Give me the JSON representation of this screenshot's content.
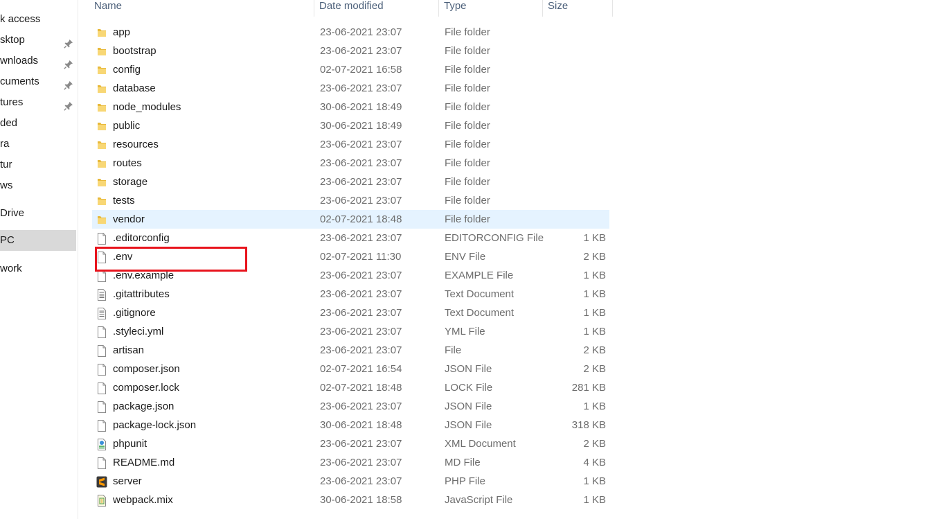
{
  "sidebar": {
    "items": [
      {
        "label": "k access",
        "icon": "star-icon",
        "pinned": false,
        "selected": false
      },
      {
        "label": "sktop",
        "icon": "desktop-icon",
        "pinned": true,
        "selected": false
      },
      {
        "label": "wnloads",
        "icon": "download-icon",
        "pinned": true,
        "selected": false
      },
      {
        "label": "cuments",
        "icon": "document-icon",
        "pinned": true,
        "selected": false
      },
      {
        "label": "tures",
        "icon": "picture-icon",
        "pinned": true,
        "selected": false
      },
      {
        "label": "ded",
        "icon": "folder-icon",
        "pinned": false,
        "selected": false
      },
      {
        "label": "ra",
        "icon": "folder-icon",
        "pinned": false,
        "selected": false
      },
      {
        "label": "tur",
        "icon": "folder-icon",
        "pinned": false,
        "selected": false
      },
      {
        "label": "ws",
        "icon": "folder-icon",
        "pinned": false,
        "selected": false
      },
      {
        "label": "Drive",
        "icon": "cloud-icon",
        "pinned": false,
        "selected": false
      },
      {
        "label": "PC",
        "icon": "computer-icon",
        "pinned": false,
        "selected": true
      },
      {
        "label": "work",
        "icon": "network-icon",
        "pinned": false,
        "selected": false
      }
    ]
  },
  "columns": {
    "name": "Name",
    "date": "Date modified",
    "type": "Type",
    "size": "Size"
  },
  "files": [
    {
      "name": "app",
      "date": "23-06-2021 23:07",
      "type": "File folder",
      "size": "",
      "icon": "folder-icon"
    },
    {
      "name": "bootstrap",
      "date": "23-06-2021 23:07",
      "type": "File folder",
      "size": "",
      "icon": "folder-icon"
    },
    {
      "name": "config",
      "date": "02-07-2021 16:58",
      "type": "File folder",
      "size": "",
      "icon": "folder-icon"
    },
    {
      "name": "database",
      "date": "23-06-2021 23:07",
      "type": "File folder",
      "size": "",
      "icon": "folder-icon"
    },
    {
      "name": "node_modules",
      "date": "30-06-2021 18:49",
      "type": "File folder",
      "size": "",
      "icon": "folder-icon"
    },
    {
      "name": "public",
      "date": "30-06-2021 18:49",
      "type": "File folder",
      "size": "",
      "icon": "folder-icon"
    },
    {
      "name": "resources",
      "date": "23-06-2021 23:07",
      "type": "File folder",
      "size": "",
      "icon": "folder-icon"
    },
    {
      "name": "routes",
      "date": "23-06-2021 23:07",
      "type": "File folder",
      "size": "",
      "icon": "folder-icon"
    },
    {
      "name": "storage",
      "date": "23-06-2021 23:07",
      "type": "File folder",
      "size": "",
      "icon": "folder-icon"
    },
    {
      "name": "tests",
      "date": "23-06-2021 23:07",
      "type": "File folder",
      "size": "",
      "icon": "folder-icon"
    },
    {
      "name": "vendor",
      "date": "02-07-2021 18:48",
      "type": "File folder",
      "size": "",
      "icon": "folder-icon",
      "hover": true
    },
    {
      "name": ".editorconfig",
      "date": "23-06-2021 23:07",
      "type": "EDITORCONFIG File",
      "size": "1 KB",
      "icon": "file-icon"
    },
    {
      "name": ".env",
      "date": "02-07-2021 11:30",
      "type": "ENV File",
      "size": "2 KB",
      "icon": "file-icon",
      "highlighted": true
    },
    {
      "name": ".env.example",
      "date": "23-06-2021 23:07",
      "type": "EXAMPLE File",
      "size": "1 KB",
      "icon": "file-icon"
    },
    {
      "name": ".gitattributes",
      "date": "23-06-2021 23:07",
      "type": "Text Document",
      "size": "1 KB",
      "icon": "text-file-icon"
    },
    {
      "name": ".gitignore",
      "date": "23-06-2021 23:07",
      "type": "Text Document",
      "size": "1 KB",
      "icon": "text-file-icon"
    },
    {
      "name": ".styleci.yml",
      "date": "23-06-2021 23:07",
      "type": "YML File",
      "size": "1 KB",
      "icon": "file-icon"
    },
    {
      "name": "artisan",
      "date": "23-06-2021 23:07",
      "type": "File",
      "size": "2 KB",
      "icon": "file-icon"
    },
    {
      "name": "composer.json",
      "date": "02-07-2021 16:54",
      "type": "JSON File",
      "size": "2 KB",
      "icon": "file-icon"
    },
    {
      "name": "composer.lock",
      "date": "02-07-2021 18:48",
      "type": "LOCK File",
      "size": "281 KB",
      "icon": "file-icon"
    },
    {
      "name": "package.json",
      "date": "23-06-2021 23:07",
      "type": "JSON File",
      "size": "1 KB",
      "icon": "file-icon"
    },
    {
      "name": "package-lock.json",
      "date": "30-06-2021 18:48",
      "type": "JSON File",
      "size": "318 KB",
      "icon": "file-icon"
    },
    {
      "name": "phpunit",
      "date": "23-06-2021 23:07",
      "type": "XML Document",
      "size": "2 KB",
      "icon": "xml-file-icon"
    },
    {
      "name": "README.md",
      "date": "23-06-2021 23:07",
      "type": "MD File",
      "size": "4 KB",
      "icon": "file-icon"
    },
    {
      "name": "server",
      "date": "23-06-2021 23:07",
      "type": "PHP File",
      "size": "1 KB",
      "icon": "sublime-text-icon"
    },
    {
      "name": "webpack.mix",
      "date": "30-06-2021 18:58",
      "type": "JavaScript File",
      "size": "1 KB",
      "icon": "javascript-file-icon"
    }
  ],
  "colors": {
    "hover_row": "#e5f3ff",
    "selected_nav": "#d9d9d9",
    "highlight_box": "#e8141d",
    "header_text": "#4c607a",
    "folder": "#f5c945"
  }
}
